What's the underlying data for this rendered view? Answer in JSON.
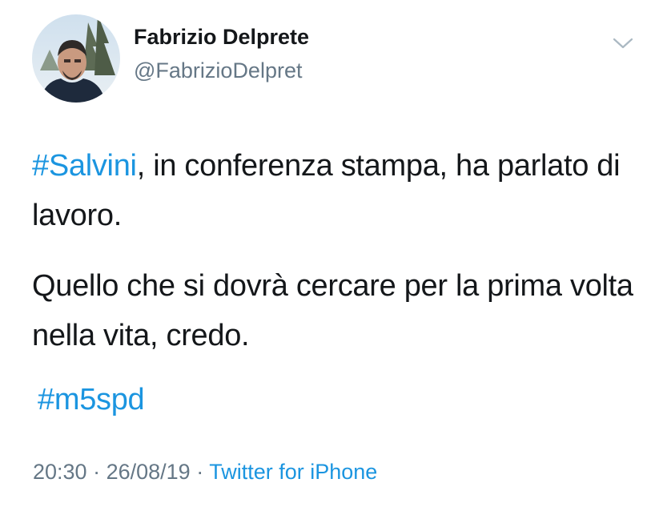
{
  "author": {
    "display_name": "Fabrizio Delprete",
    "handle": "@FabrizioDelpret",
    "avatar_icon": "user-avatar-photo"
  },
  "menu": {
    "caret_icon": "chevron-down-icon"
  },
  "tweet": {
    "paragraph1": {
      "hashtag": "#Salvini",
      "text": ", in conferenza stampa, ha parlato di lavoro."
    },
    "paragraph2": {
      "text": "Quello che si dovrà cercare per la prima volta nella vita, credo."
    },
    "paragraph3": {
      "hashtag": "#m5spd"
    }
  },
  "meta": {
    "time": "20:30",
    "separator1": " · ",
    "date": "26/08/19",
    "separator2": " · ",
    "source": "Twitter for iPhone"
  },
  "colors": {
    "link": "#1b95e0",
    "text": "#14171a",
    "secondary": "#657786"
  }
}
